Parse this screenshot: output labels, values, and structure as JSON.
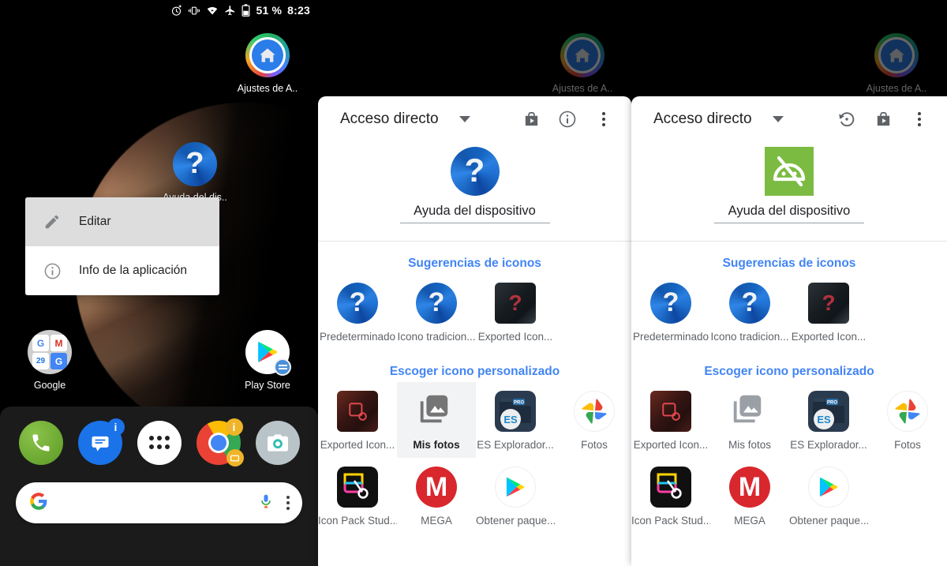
{
  "statusbar": {
    "icons": [
      "alarm-icon",
      "vibrate-icon",
      "wifi-icon",
      "airplane-mode-icon",
      "battery-icon"
    ],
    "battery_percent": "51 %",
    "time": "8:23"
  },
  "homescreen": {
    "apps": [
      {
        "label": "Ajustes de A..",
        "icon": "app-settings-icon"
      },
      {
        "label": "Ayuda del dis..",
        "icon": "question-mark-icon"
      },
      {
        "label": "Google",
        "icon": "google-folder-icon"
      },
      {
        "label": "Play Store",
        "icon": "play-store-icon"
      }
    ],
    "dock": [
      {
        "label": "Teléfono",
        "icon": "phone-icon"
      },
      {
        "label": "Mensajes",
        "icon": "messages-icon"
      },
      {
        "label": "Todas las aplicaciones",
        "icon": "app-drawer-icon"
      },
      {
        "label": "Chrome",
        "icon": "chrome-icon"
      },
      {
        "label": "Cámara",
        "icon": "camera-icon"
      }
    ],
    "search": {
      "logo": "google-g-icon",
      "mic": "microphone-icon",
      "overflow": "more-vertical-icon",
      "placeholder": ""
    }
  },
  "context_menu": {
    "items": [
      {
        "label": "Editar",
        "icon": "pencil-icon",
        "selected": true
      },
      {
        "label": "Info de la aplicación",
        "icon": "info-icon",
        "selected": false
      }
    ]
  },
  "ghost_apps": [
    {
      "label": "Ajustes de A.."
    },
    {
      "label": "Ajustes de A.."
    }
  ],
  "panels": [
    {
      "id": "panel-left",
      "toolbar": {
        "title": "Acceso directo",
        "dropdown": "chevron-down-icon",
        "actions": [
          "store-export-icon",
          "info-icon",
          "more-vertical-icon"
        ]
      },
      "preview": {
        "icon": "question-mark-icon",
        "name": "Ayuda del dispositivo"
      },
      "sections": [
        {
          "title": "Sugerencias de iconos",
          "rows": [
            [
              {
                "label": "Predeterminado",
                "icon": "question-mark-icon",
                "selected": false
              },
              {
                "label": "Icono tradicion...",
                "icon": "question-mark-icon",
                "selected": false
              },
              {
                "label": "Exported Icon...",
                "icon": "exported-icon-dark",
                "selected": false
              }
            ]
          ]
        },
        {
          "title": "Escoger icono personalizado",
          "rows": [
            [
              {
                "label": "Exported Icon...",
                "icon": "exported-icon-red",
                "selected": false
              },
              {
                "label": "Mis fotos",
                "icon": "photo-library-icon",
                "selected": true
              },
              {
                "label": "ES Explorador...",
                "icon": "es-file-explorer-icon",
                "selected": false
              },
              {
                "label": "Fotos",
                "icon": "google-photos-icon",
                "selected": false
              }
            ],
            [
              {
                "label": "Icon Pack Stud...",
                "icon": "icon-pack-studio-icon",
                "selected": false
              },
              {
                "label": "MEGA",
                "icon": "mega-icon",
                "selected": false
              },
              {
                "label": "Obtener paque...",
                "icon": "play-store-icon",
                "selected": false
              }
            ]
          ]
        }
      ]
    },
    {
      "id": "panel-right",
      "toolbar": {
        "title": "Acceso directo",
        "dropdown": "chevron-down-icon",
        "actions": [
          "restore-icon",
          "store-export-icon",
          "more-vertical-icon"
        ]
      },
      "preview": {
        "icon": "android-green-icon",
        "name": "Ayuda del dispositivo"
      },
      "sections": [
        {
          "title": "Sugerencias de iconos",
          "rows": [
            [
              {
                "label": "Predeterminado",
                "icon": "question-mark-icon",
                "selected": false
              },
              {
                "label": "Icono tradicion...",
                "icon": "question-mark-icon",
                "selected": false
              },
              {
                "label": "Exported Icon...",
                "icon": "exported-icon-dark",
                "selected": false
              }
            ]
          ]
        },
        {
          "title": "Escoger icono personalizado",
          "rows": [
            [
              {
                "label": "Exported Icon...",
                "icon": "exported-icon-red",
                "selected": false
              },
              {
                "label": "Mis fotos",
                "icon": "photo-library-icon",
                "selected": false
              },
              {
                "label": "ES Explorador...",
                "icon": "es-file-explorer-icon",
                "selected": false
              },
              {
                "label": "Fotos",
                "icon": "google-photos-icon",
                "selected": false
              }
            ],
            [
              {
                "label": "Icon Pack Stud...",
                "icon": "icon-pack-studio-icon",
                "selected": false
              },
              {
                "label": "MEGA",
                "icon": "mega-icon",
                "selected": false
              },
              {
                "label": "Obtener paque...",
                "icon": "play-store-icon",
                "selected": false
              }
            ]
          ]
        }
      ]
    }
  ],
  "colors": {
    "accent_blue": "#4285f4",
    "panel_bg": "#ffffff",
    "selected_cell": "#f1f3f4",
    "android_green": "#7cbb42",
    "mega_red": "#d9272e"
  }
}
